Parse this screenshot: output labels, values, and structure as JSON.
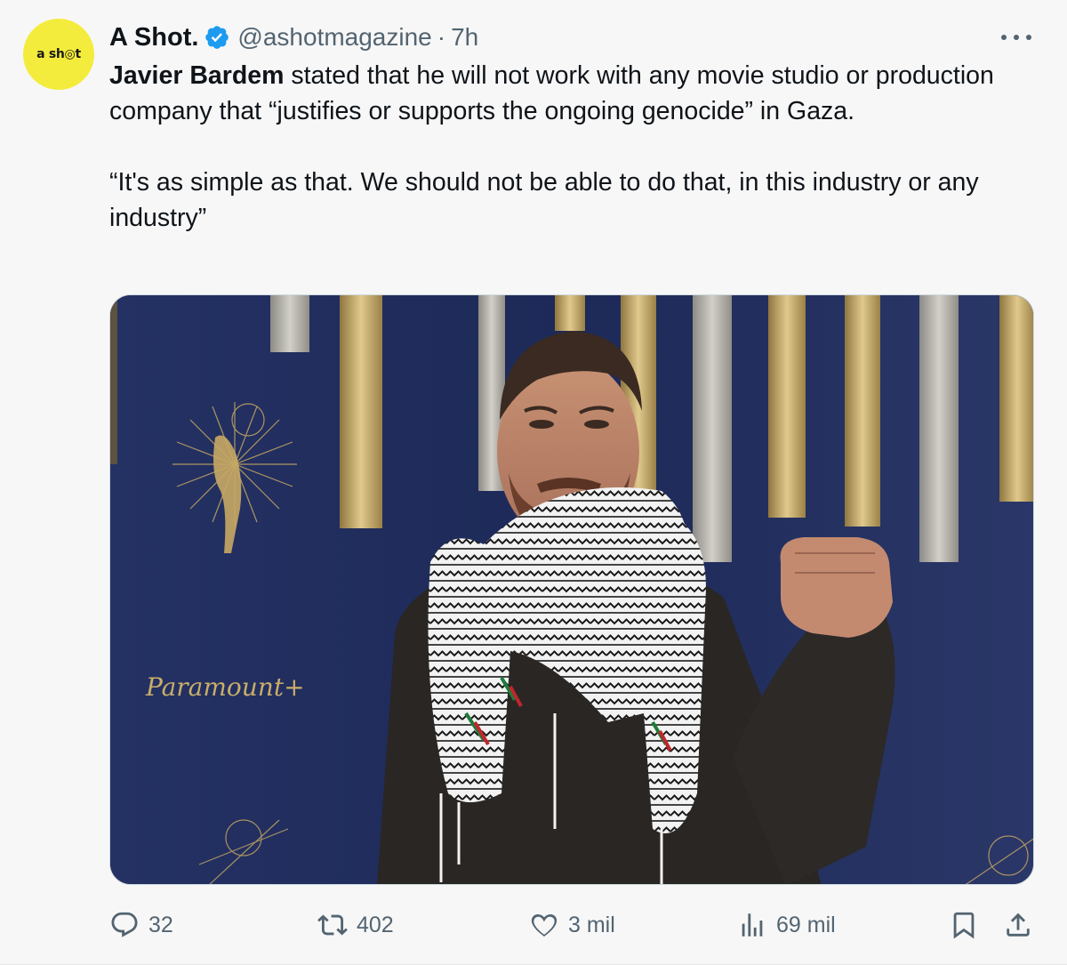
{
  "author": {
    "avatar_text": "a sh◎t",
    "display_name": "A Shot.",
    "handle": "@ashotmagazine",
    "separator": "·",
    "time": "7h",
    "verified_color": "#1d9bf0",
    "avatar_color": "#f3ec3c"
  },
  "tweet": {
    "paragraph1_bold": "Javier Bardem",
    "paragraph1_rest": " stated that he will not work with any movie studio or production company that “justifies or supports the ongoing genocide” in Gaza.",
    "paragraph2": "“It's as simple as that. We should not be able to do that, in this industry or any industry”"
  },
  "media": {
    "backdrop_logo_text": "Paramount+"
  },
  "actions": {
    "replies": "32",
    "reposts": "402",
    "likes": "3 mil",
    "views": "69 mil",
    "icons": [
      "reply-icon",
      "repost-icon",
      "like-icon",
      "views-icon",
      "bookmark-icon",
      "share-icon"
    ]
  },
  "colors": {
    "text_primary": "#0f1419",
    "text_secondary": "#536471",
    "background": "#f7f7f7"
  }
}
